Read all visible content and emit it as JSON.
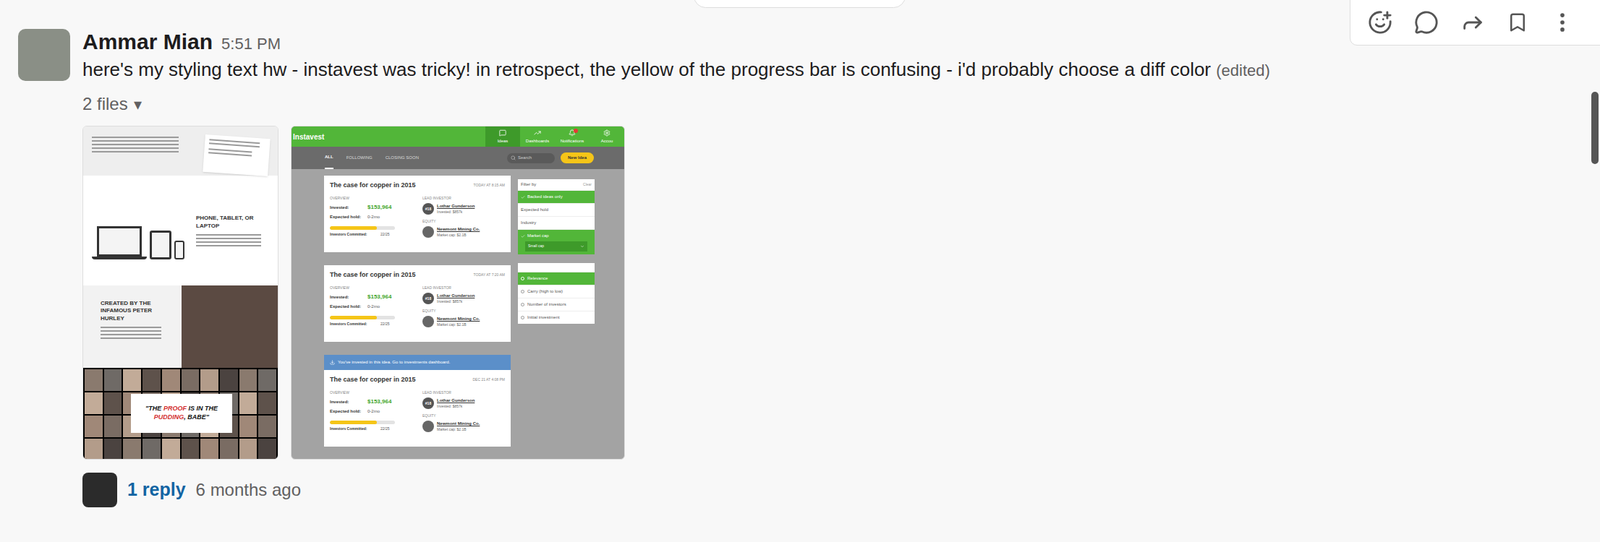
{
  "message": {
    "author": "Ammar Mian",
    "time": "5:51 PM",
    "text": "here's my styling text hw - instavest was tricky! in retrospect, the yellow of the progress bar is confusing - i'd probably choose a diff color",
    "edited": "(edited)"
  },
  "files": {
    "label": "2 files",
    "toggle": "▾"
  },
  "landing_page": {
    "devices_heading": "PHONE, TABLET, OR LAPTOP",
    "creator_heading": "CREATED BY THE INFAMOUS PETER HURLEY",
    "quote": [
      {
        "text": "\"THE ",
        "color": "#111111"
      },
      {
        "text": "PROOF",
        "color": "#d32f2f"
      },
      {
        "text": " IS IN THE ",
        "color": "#111111"
      },
      {
        "text": "PUDDING",
        "color": "#d32f2f"
      },
      {
        "text": ", BABE\"",
        "color": "#111111"
      }
    ]
  },
  "instavest": {
    "title": "Instavest",
    "nav": [
      {
        "label": "Ideas",
        "selected": true,
        "badge": false
      },
      {
        "label": "Dashboards",
        "selected": false,
        "badge": false
      },
      {
        "label": "Notifications",
        "selected": false,
        "badge": true
      },
      {
        "label": "Accou",
        "selected": false,
        "badge": false
      }
    ],
    "tabs": [
      {
        "label": "ALL",
        "selected": true
      },
      {
        "label": "FOLLOWING",
        "selected": false
      },
      {
        "label": "CLOSING SOON",
        "selected": false
      }
    ],
    "search": {
      "placeholder": "Search"
    },
    "new_button": "New Idea",
    "cards": [
      {
        "banner": "",
        "title": "The case for copper in 2015",
        "time": "TODAY AT 8:15 AM",
        "overview_label": "OVERVIEW",
        "invested_label": "Invested:",
        "invested": "$153,964",
        "hold_label": "Expected hold:",
        "hold": "0-2mo",
        "level": 0.72,
        "committed_label": "Investors Committed:",
        "committed": "22/25",
        "lead_label": "LEAD INVESTOR",
        "lead_badge": "#18",
        "lead_name": "Lothar Gunderson",
        "lead_invested": "Invested: $857k",
        "equity_label": "EQUITY",
        "company": "Newmont Mining Co.",
        "market_cap": "Market cap: $2.1B"
      },
      {
        "banner": "",
        "title": "The case for copper in 2015",
        "time": "TODAY AT 7:20 AM",
        "overview_label": "OVERVIEW",
        "invested_label": "Invested:",
        "invested": "$153,964",
        "hold_label": "Expected hold:",
        "hold": "0-2mo",
        "level": 0.72,
        "committed_label": "Investors Committed:",
        "committed": "22/25",
        "lead_label": "LEAD INVESTOR",
        "lead_badge": "#18",
        "lead_name": "Lothar Gunderson",
        "lead_invested": "Invested: $857k",
        "equity_label": "EQUITY",
        "company": "Newmont Mining Co.",
        "market_cap": "Market cap: $2.1B"
      },
      {
        "banner": "You've invested in this idea. Go to investments dashboard.",
        "title": "The case for copper in 2015",
        "time": "DEC 21 AT 4:08 PM",
        "overview_label": "OVERVIEW",
        "invested_label": "Invested:",
        "invested": "$153,964",
        "hold_label": "Expected hold:",
        "hold": "0-2mo",
        "level": 0.72,
        "committed_label": "Investors Committed:",
        "committed": "22/25",
        "lead_label": "LEAD INVESTOR",
        "lead_badge": "#18",
        "lead_name": "Lothar Gunderson",
        "lead_invested": "Invested: $857k",
        "equity_label": "EQUITY",
        "company": "Newmont Mining Co.",
        "market_cap": "Market cap: $2.1B"
      }
    ],
    "filter": {
      "title": "Filter by",
      "clear": "Clear",
      "items": [
        {
          "label": "Backed ideas only",
          "checked": true,
          "select": ""
        },
        {
          "label": "Expected hold",
          "checked": false,
          "select": ""
        },
        {
          "label": "Industry",
          "checked": false,
          "select": ""
        },
        {
          "label": "Market cap",
          "checked": true,
          "select": "Small cap"
        }
      ]
    },
    "sort": [
      {
        "label": "Relevance",
        "selected": true
      },
      {
        "label": "Carry (high to low)",
        "selected": false
      },
      {
        "label": "Number of investors",
        "selected": false
      },
      {
        "label": "Initial investment",
        "selected": false
      }
    ]
  },
  "thread": {
    "replies": "1 reply",
    "time": "6 months ago"
  }
}
